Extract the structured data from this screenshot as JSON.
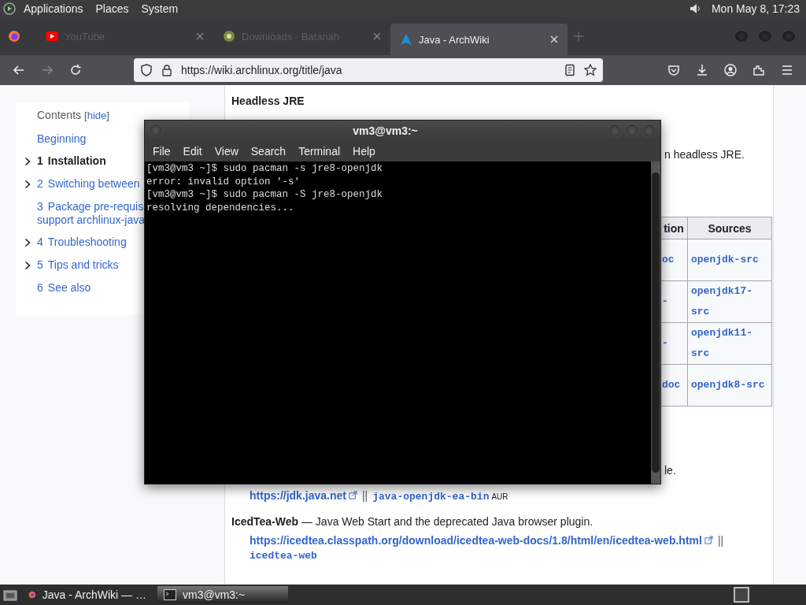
{
  "top_panel": {
    "menus": [
      "Applications",
      "Places",
      "System"
    ],
    "clock": "Mon May  8, 17:23"
  },
  "browser": {
    "tabs": [
      {
        "title": "YouTube",
        "selected": false,
        "kind": "youtube"
      },
      {
        "title": "Downloads · Batanah",
        "selected": false,
        "kind": "downloads"
      },
      {
        "title": "Java - ArchWiki",
        "selected": true,
        "kind": "arch"
      }
    ],
    "url": "https://wiki.archlinux.org/title/java"
  },
  "toc": {
    "title": "Contents",
    "bracket_open": "[",
    "toggle": "hide",
    "bracket_close": "]",
    "items": [
      {
        "label": "Beginning",
        "selected": false,
        "collapsible": false
      },
      {
        "number": "1",
        "label": "Installation",
        "selected": true,
        "collapsible": true
      },
      {
        "number": "2",
        "label": "Switching between",
        "selected": false,
        "collapsible": true
      },
      {
        "number": "3",
        "label": "Package pre-requis\nsupport archlinux-java",
        "selected": false,
        "collapsible": false
      },
      {
        "number": "4",
        "label": "Troubleshooting",
        "selected": false,
        "collapsible": true
      },
      {
        "number": "5",
        "label": "Tips and tricks",
        "selected": false,
        "collapsible": true
      },
      {
        "number": "6",
        "label": "See also",
        "selected": false,
        "collapsible": false
      }
    ]
  },
  "article": {
    "heading": "Headless JRE",
    "fragment_1": "n headless JRE.",
    "table": {
      "columns": [
        "tion",
        "Sources"
      ],
      "rows": [
        [
          "oc",
          "openjdk-src"
        ],
        [
          "-",
          "openjdk17-src"
        ],
        [
          "-",
          "openjdk11-src"
        ],
        [
          "doc",
          "openjdk8-src"
        ]
      ]
    },
    "fragment_2": "le.",
    "entries": [
      {
        "link": "https://jdk.java.net",
        "separator": "||",
        "package": "java-openjdk-ea-bin",
        "package_note": "AUR"
      },
      {
        "description": "**IcedTea-Web** — Java Web Start and the deprecated Java browser plugin.",
        "link": "https://icedtea.classpath.org/download/icedtea-web-docs/1.8/html/en/icedtea-web.html",
        "separator": "||",
        "package": "icedtea-web"
      }
    ]
  },
  "terminal": {
    "title": "vm3@vm3:~",
    "menus": [
      "File",
      "Edit",
      "View",
      "Search",
      "Terminal",
      "Help"
    ],
    "lines": [
      "[vm3@vm3 ~]$ sudo pacman -s jre8-openjdk",
      "error: invalid option '-s'",
      "[vm3@vm3 ~]$ sudo pacman -S jre8-openjdk",
      "resolving dependencies..."
    ]
  },
  "taskbar": {
    "tasks": [
      {
        "title": "Java - ArchWiki — …",
        "selected": false,
        "kind": "browser"
      },
      {
        "title": "vm3@vm3:~",
        "selected": true,
        "kind": "terminal"
      }
    ]
  }
}
